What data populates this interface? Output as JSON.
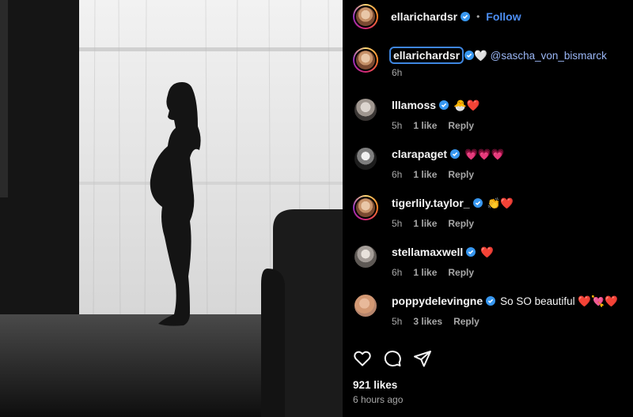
{
  "post": {
    "author": "ellarichardsr",
    "follow_label": "Follow",
    "separator": "•",
    "caption": {
      "username": "ellarichardsr",
      "emoji": "🤍",
      "mention": "@sascha_von_bismarck",
      "time": "6h"
    },
    "comments": [
      {
        "username": "lllamoss",
        "text": "🐣❤️",
        "time": "5h",
        "likes": "1 like",
        "reply": "Reply"
      },
      {
        "username": "clarapaget",
        "text": "💗💗💗",
        "time": "6h",
        "likes": "1 like",
        "reply": "Reply"
      },
      {
        "username": "tigerlily.taylor_",
        "text": "👏❤️",
        "time": "5h",
        "likes": "1 like",
        "reply": "Reply"
      },
      {
        "username": "stellamaxwell",
        "text": "❤️",
        "time": "6h",
        "likes": "1 like",
        "reply": "Reply"
      },
      {
        "username": "poppydelevingne",
        "text": "So SO beautiful ❤️💘❤️",
        "time": "5h",
        "likes": "3 likes",
        "reply": "Reply"
      }
    ],
    "likes_total": "921 likes",
    "posted_ago": "6 hours ago"
  },
  "icons": {
    "like": "heart-icon",
    "comment": "comment-icon",
    "share": "paper-plane-icon",
    "verified": "verified-badge-icon"
  },
  "colors": {
    "accent": "#4d8ff5",
    "verified": "#3797f0",
    "muted": "#a8a8a8",
    "background": "#000000"
  }
}
